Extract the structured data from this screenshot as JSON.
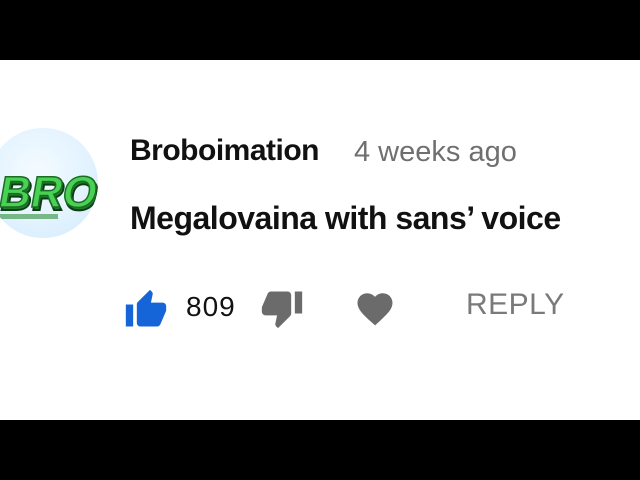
{
  "comment": {
    "author": "Broboimation",
    "timestamp": "4 weeks ago",
    "text": "Megalovaina with sans’ voice",
    "avatar_text": "BRO",
    "like_count": "809",
    "reply_label": "REPLY"
  },
  "colors": {
    "like_active": "#1565d8",
    "icon_gray": "#6b6b6b",
    "avatar_letters": "#3fbf4a"
  },
  "icons": {
    "like": "thumbs-up-icon",
    "dislike": "thumbs-down-icon",
    "heart": "heart-icon"
  }
}
